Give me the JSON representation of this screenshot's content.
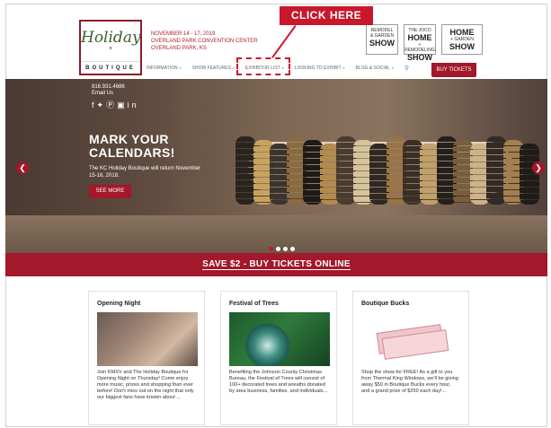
{
  "annotation": {
    "click_here": "CLICK HERE"
  },
  "logo": {
    "script": "Holiday",
    "x": "×",
    "boutique": "BOUTIQUE"
  },
  "event": {
    "dates": "NOVEMBER 14 - 17, 2019",
    "venue": "OVERLAND PARK CONVENTION CENTER",
    "city": "OVERLAND PARK, KS"
  },
  "show_logos": [
    {
      "top": "REMODEL",
      "mid": "& GARDEN",
      "main": "SHOW"
    },
    {
      "top": "THE JOCO",
      "mid": "HOME",
      "main": "SHOW",
      "sub": "+ REMODELING"
    },
    {
      "top": "HOME",
      "mid": "+ GARDEN",
      "main": "SHOW"
    }
  ],
  "nav": {
    "items": [
      "INFORMATION",
      "SHOW FEATURES",
      "EXHIBITOR LIST",
      "LOOKING TO EXHIBIT",
      "BLOG & SOCIAL"
    ],
    "buy_tickets": "BUY TICKETS"
  },
  "hero": {
    "phone": "816.931.4686",
    "email": "Email Us",
    "title_line1": "MARK YOUR",
    "title_line2": "CALENDARS!",
    "text": "The KC Holiday Boutique will return November 15-18, 2018.",
    "cta": "SEE MORE",
    "slide_count": 4,
    "active_slide": 0
  },
  "save_bar": "SAVE $2 - BUY TICKETS ONLINE",
  "cards": [
    {
      "title": "Opening Night",
      "body": "Join KMXV and The Holiday Boutique for Opening Night on Thursday! Come enjoy more music, prizes and shopping than ever before! Don't miss out on the night that only our biggest fans have known about ..."
    },
    {
      "title": "Festival of Trees",
      "body": "Benefiting the Johnson County Christmas Bureau, the Festival of Trees will consist of 100+ decorated trees and wreaths donated by area business, families, and individuals..."
    },
    {
      "title": "Boutique Bucks",
      "body": "Shop the show for FREE! As a gift to you from Thermal King Windows, we'll be giving away $50 in Boutique Bucks every hour, and a grand prize of $250 each day!..."
    }
  ],
  "colors": {
    "brand_red": "#a3182a",
    "annotation_red": "#c8182b",
    "logo_green": "#3b5f2e"
  }
}
